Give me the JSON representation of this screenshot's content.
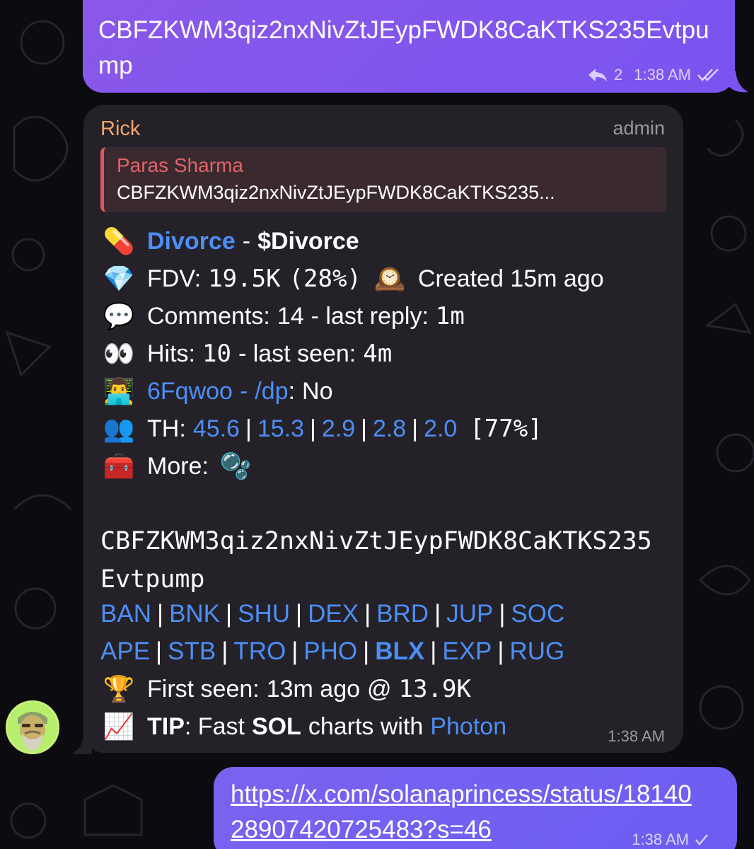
{
  "top_message": {
    "text": "CBFZKWM3qiz2nxNivZtJEypFWDK8CaKTKS235Evtpump",
    "replies_count": "2",
    "time": "1:38 AM"
  },
  "bot_message": {
    "sender": "Rick",
    "role": "admin",
    "reply": {
      "name": "Paras Sharma",
      "text": "CBFZKWM3qiz2nxNivZtJEypFWDK8CaKTKS235..."
    },
    "token_line": {
      "name": "Divorce",
      "dash": "-",
      "ticker": "$Divorce"
    },
    "fdv_line": {
      "label": "FDV:",
      "value": "19.5K",
      "pct": "(28%)",
      "created": "Created 15m ago"
    },
    "comments_line": {
      "label": "Comments:",
      "count": "14",
      "rest": "- last reply:",
      "last": "1m"
    },
    "hits_line": {
      "label": "Hits:",
      "count": "10",
      "rest": "- last seen:",
      "last": "4m"
    },
    "dev_line": {
      "dev": "6Fqwoo",
      "dash": "-",
      "dp": "/dp",
      "colon": ":",
      "value": "No"
    },
    "th_line": {
      "label": "TH:",
      "values": [
        "45.6",
        "15.3",
        "2.9",
        "2.8",
        "2.0"
      ],
      "total": "[77%]"
    },
    "more_line": {
      "label": "More:"
    },
    "contract": "CBFZKWM3qiz2nxNivZtJEypFWDK8CaKTKS235Evtpump",
    "links_row1": [
      "BAN",
      "BNK",
      "SHU",
      "DEX",
      "BRD",
      "JUP",
      "SOC"
    ],
    "links_row2": [
      "APE",
      "STB",
      "TRO",
      "PHO",
      "BLX",
      "EXP",
      "RUG"
    ],
    "first_seen": {
      "label": "First seen:",
      "time": "13m ago",
      "at": "@",
      "value": "13.9K"
    },
    "tip": {
      "label": "TIP",
      "text1": ": Fast",
      "sol": "SOL",
      "text2": "charts with",
      "link": "Photon"
    },
    "time": "1:38 AM"
  },
  "bottom_message": {
    "url": "https://x.com/solanaprincess/status/1814028907420725483?s=46",
    "time": "1:38 AM"
  },
  "icons": {
    "pill": "💊",
    "gem": "💎",
    "clock": "🕰️",
    "speech": "💬",
    "eyes": "👀",
    "dev": "👨‍💻",
    "people": "👥",
    "toolbox": "🧰",
    "bubbles": "🫧",
    "trophy": "🏆",
    "chart": "📈"
  },
  "colors": {
    "outgoing_bubble": "#8a57ea",
    "incoming_bubble": "#242228",
    "link": "#4d8ef5",
    "sender_name": "#f5a46a",
    "reply_name": "#e5626a",
    "avatar_bg": "#b7ee6c"
  }
}
